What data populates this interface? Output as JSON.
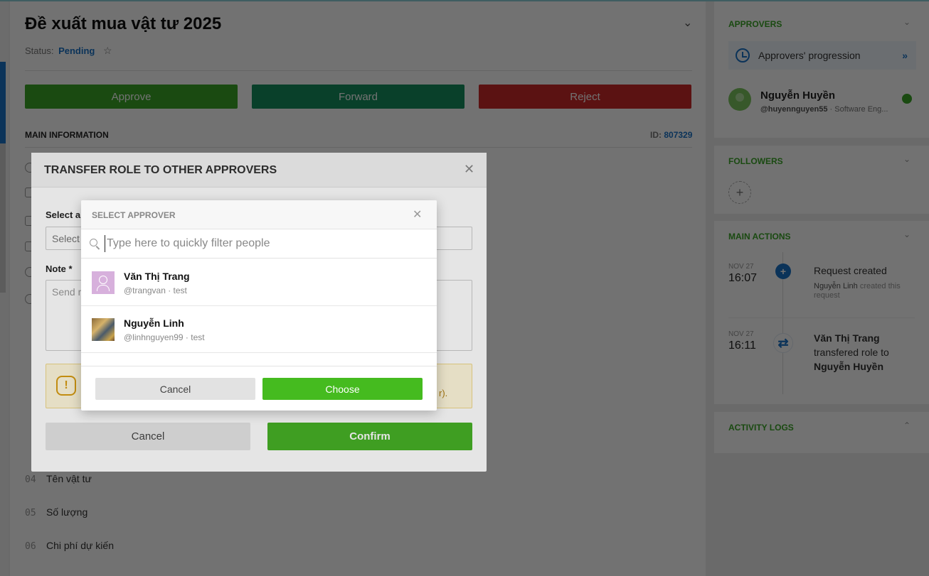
{
  "request": {
    "title": "Đề xuất mua vật tư 2025",
    "status_label": "Status:",
    "status_value": "Pending",
    "approve_label": "Approve",
    "forward_label": "Forward",
    "reject_label": "Reject",
    "main_info_label": "MAIN INFORMATION",
    "id_label": "ID:",
    "id_value": "807329",
    "fields": [
      {
        "index": "04",
        "label": "Tên vật tư"
      },
      {
        "index": "05",
        "label": "Số lượng"
      },
      {
        "index": "06",
        "label": "Chi phí dự kiến"
      }
    ]
  },
  "sidebar": {
    "approvers_title": "APPROVERS",
    "progression_label": "Approvers' progression",
    "approver": {
      "name": "Nguyễn Huyền",
      "handle": "@huyennguyen55",
      "role": " · Software Eng..."
    },
    "followers_title": "FOLLOWERS",
    "main_actions_title": "MAIN ACTIONS",
    "timeline": [
      {
        "date": "NOV 27",
        "time": "16:07",
        "title": "Request created",
        "actor": "Nguyễn Linh",
        "sub": " created this request"
      },
      {
        "date": "NOV 27",
        "time": "16:11",
        "actor": "Văn Thị Trang",
        "action": "transfered role to",
        "target": "Nguyễn Huyền"
      }
    ],
    "activity_logs_title": "ACTIVITY LOGS"
  },
  "transfer_modal": {
    "title": "TRANSFER ROLE TO OTHER APPROVERS",
    "select_label": "Select ap",
    "select_placeholder": "Select",
    "note_label": "Note *",
    "note_placeholder": "Send m",
    "warning_tail": "r).",
    "cancel_label": "Cancel",
    "confirm_label": "Confirm"
  },
  "select_dialog": {
    "title": "SELECT APPROVER",
    "search_placeholder": "Type here to quickly filter people",
    "people": [
      {
        "name": "Văn Thị Trang",
        "sub": "@trangvan · test"
      },
      {
        "name": "Nguyễn Linh",
        "sub": "@linhnguyen99 · test"
      }
    ],
    "cancel_label": "Cancel",
    "choose_label": "Choose"
  },
  "colors": {
    "accent_green": "#3aa628",
    "link_blue": "#1a73c8",
    "reject_red": "#cc2b2b",
    "forward_teal": "#17905e"
  }
}
